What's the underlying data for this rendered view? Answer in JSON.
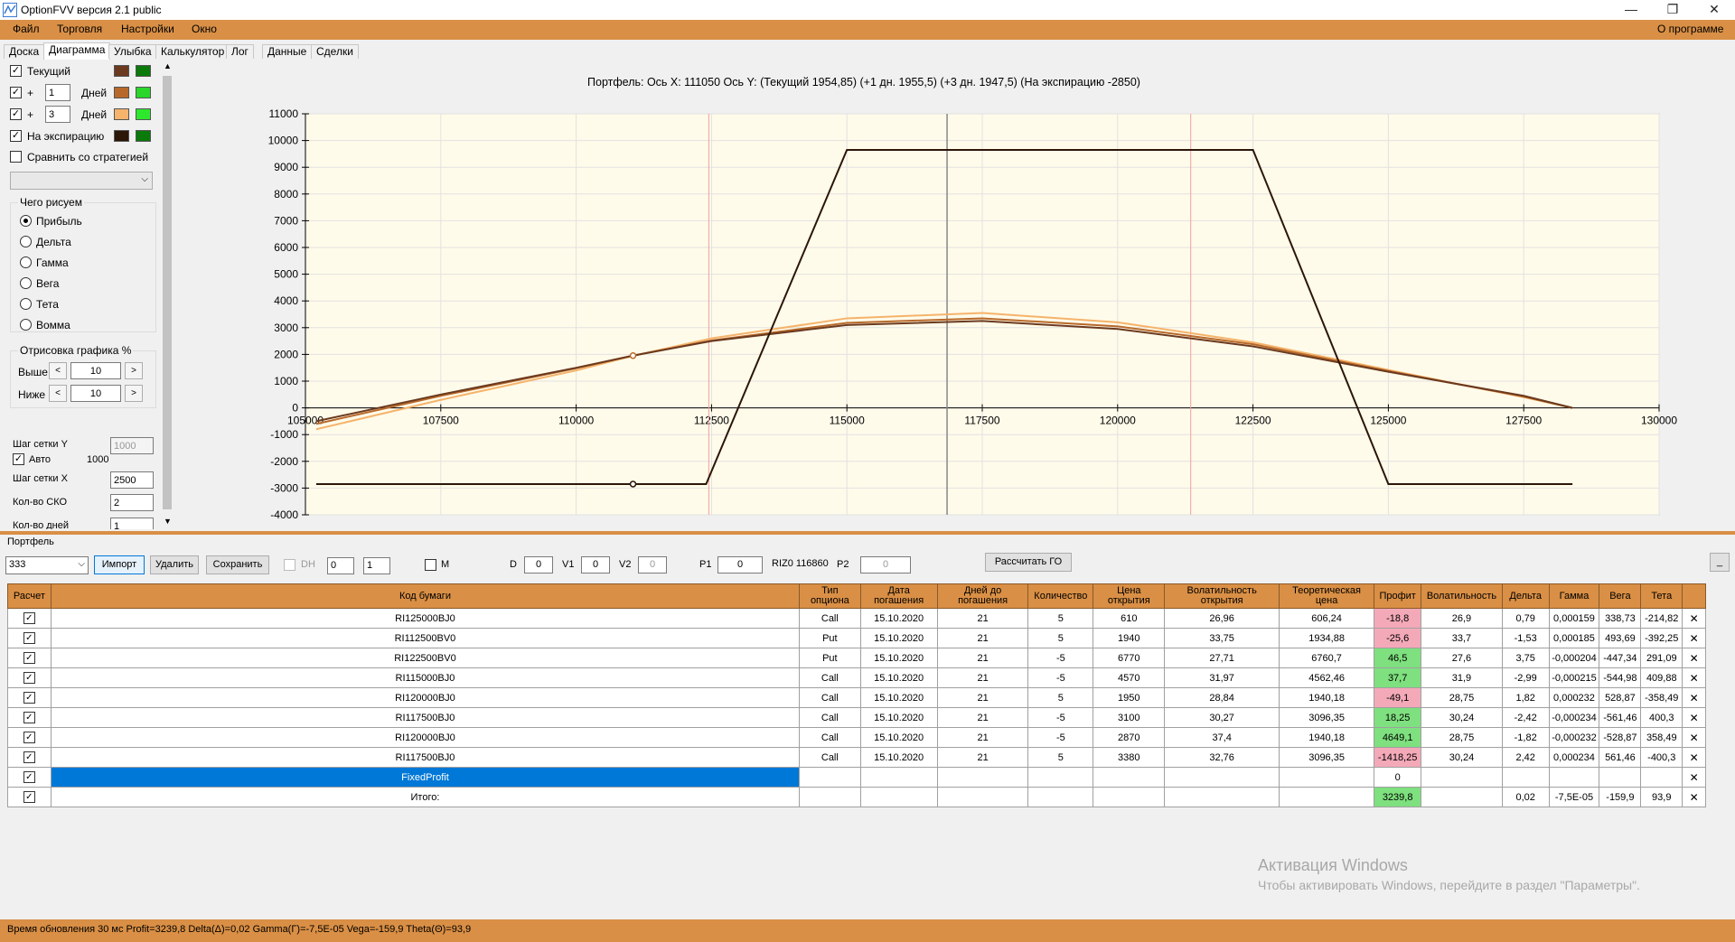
{
  "window": {
    "title": "OptionFVV версия 2.1 public",
    "min": "—",
    "max": "❐",
    "close": "✕"
  },
  "menu": {
    "items": [
      "Файл",
      "Торговля",
      "Настройки",
      "Окно"
    ],
    "right": "О программе"
  },
  "tabs": [
    "Доска",
    "Диаграмма",
    "Улыбка",
    "Калькулятор",
    "Лог",
    "Данные",
    "Сделки"
  ],
  "left": {
    "current_label": "Текущий",
    "plus": "+",
    "days1": "1",
    "days3": "3",
    "days_label": "Дней",
    "expiry_label": "На экспирацию",
    "compare_label": "Сравнить со стратегией",
    "what_group": "Чего рисуем",
    "radios": [
      "Прибыль",
      "Дельта",
      "Гамма",
      "Вега",
      "Тета",
      "Вомма"
    ],
    "draw_group": "Отрисовка графика %",
    "above_label": "Выше",
    "above_val": "10",
    "below_label": "Ниже",
    "below_val": "10",
    "stepy_label": "Шаг сетки Y",
    "stepy_val": "1000",
    "auto_label": "Авто",
    "auto_val": "1000",
    "stepx_label": "Шаг сетки X",
    "stepx_val": "2500",
    "sko_label": "Кол-во СКО",
    "sko_val": "2",
    "days_count_label": "Кол-во дней",
    "days_count_val": "1",
    "colors": {
      "cur_brown": "#6b3a1f",
      "cur_green": "#0b7a0b",
      "d1_brown": "#b8692a",
      "d1_green": "#29d629",
      "d3_orange": "#f5b36b",
      "d3_green": "#2ee82e",
      "exp_dark": "#2b1608",
      "exp_green": "#0a7a0a"
    }
  },
  "chart_data": {
    "type": "line",
    "title": "Портфель: Ось X:  111050 Ось Y:  (Текущий 1954,85)  (+1 дн. 1955,5)  (+3 дн. 1947,5)  (На экспирацию -2850)",
    "xlim": [
      105000,
      130000
    ],
    "ylim": [
      -4000,
      11000
    ],
    "xticks": [
      105000,
      107500,
      110000,
      112500,
      115000,
      117500,
      120000,
      122500,
      125000,
      127500,
      130000
    ],
    "yticks": [
      11000,
      10000,
      9000,
      8000,
      7000,
      6000,
      5000,
      4000,
      3000,
      2000,
      1000,
      0,
      -1000,
      -2000,
      -3000,
      -4000
    ],
    "grid": true,
    "cursor_x": 116850,
    "sd_lines": [
      112450,
      121350
    ],
    "series": [
      {
        "color": "#2b1608",
        "x": [
          105200,
          112400,
          115000,
          122500,
          125000,
          128400
        ],
        "y": [
          -2850,
          -2850,
          9650,
          9650,
          -2850,
          -2850
        ]
      },
      {
        "color": "#6b3a1f",
        "x": [
          105200,
          107500,
          110000,
          111050,
          112500,
          115000,
          117500,
          120000,
          122500,
          125000,
          127500,
          128400
        ],
        "y": [
          -500,
          500,
          1500,
          1955,
          2500,
          3100,
          3250,
          2950,
          2300,
          1350,
          450,
          0
        ]
      },
      {
        "color": "#b8692a",
        "x": [
          105200,
          107500,
          110000,
          111050,
          112500,
          115000,
          117500,
          120000,
          122500,
          125000,
          127500,
          128400
        ],
        "y": [
          -600,
          450,
          1480,
          1955,
          2520,
          3180,
          3350,
          3050,
          2380,
          1380,
          420,
          0
        ]
      },
      {
        "color": "#f5b36b",
        "x": [
          105200,
          107500,
          110000,
          111050,
          112500,
          115000,
          117500,
          120000,
          122500,
          125000,
          127500,
          128400
        ],
        "y": [
          -800,
          300,
          1400,
          1947,
          2600,
          3350,
          3550,
          3200,
          2450,
          1420,
          400,
          0
        ]
      }
    ],
    "markers": [
      {
        "x": 111050,
        "y": 1955,
        "color": "#b8692a"
      },
      {
        "x": 111050,
        "y": -2850,
        "color": "#2b1608"
      }
    ]
  },
  "portfolio": {
    "label": "Портфель",
    "combo": "333",
    "buttons": [
      "Импорт",
      "Удалить",
      "Сохранить"
    ],
    "dh": "DH",
    "spin1": "0",
    "spin2": "1",
    "m": "M",
    "d_label": "D",
    "d_val": "0",
    "v1_label": "V1",
    "v1_val": "0",
    "v2_label": "V2",
    "v2_val": "0",
    "p1_label": "P1",
    "p1_val": "0",
    "riz": "RIZ0 116860",
    "p2_label": "P2",
    "p2_val": "0",
    "calc_btn": "Рассчитать ГО",
    "min_btn": "_",
    "headers": [
      "Расчет",
      "Код бумаги",
      "Тип опциона",
      "Дата погашения",
      "Дней до погашения",
      "Количество",
      "Цена открытия",
      "Волатильность открытия",
      "Теоретическая цена",
      "Профит",
      "Волатильность",
      "Дельта",
      "Гамма",
      "Вега",
      "Тета",
      ""
    ],
    "rows": [
      {
        "code": "RI125000BJ0",
        "type": "Call",
        "date": "15.10.2020",
        "days": "21",
        "qty": "5",
        "price": "610",
        "vol_open": "26,96",
        "theo": "606,24",
        "profit": "-18,8",
        "pclass": "red",
        "vol": "26,9",
        "delta": "0,79",
        "gamma": "0,000159",
        "vega": "338,73",
        "theta": "-214,82"
      },
      {
        "code": "RI112500BV0",
        "type": "Put",
        "date": "15.10.2020",
        "days": "21",
        "qty": "5",
        "price": "1940",
        "vol_open": "33,75",
        "theo": "1934,88",
        "profit": "-25,6",
        "pclass": "red",
        "vol": "33,7",
        "delta": "-1,53",
        "gamma": "0,000185",
        "vega": "493,69",
        "theta": "-392,25"
      },
      {
        "code": "RI122500BV0",
        "type": "Put",
        "date": "15.10.2020",
        "days": "21",
        "qty": "-5",
        "price": "6770",
        "vol_open": "27,71",
        "theo": "6760,7",
        "profit": "46,5",
        "pclass": "green",
        "vol": "27,6",
        "delta": "3,75",
        "gamma": "-0,000204",
        "vega": "-447,34",
        "theta": "291,09"
      },
      {
        "code": "RI115000BJ0",
        "type": "Call",
        "date": "15.10.2020",
        "days": "21",
        "qty": "-5",
        "price": "4570",
        "vol_open": "31,97",
        "theo": "4562,46",
        "profit": "37,7",
        "pclass": "green",
        "vol": "31,9",
        "delta": "-2,99",
        "gamma": "-0,000215",
        "vega": "-544,98",
        "theta": "409,88"
      },
      {
        "code": "RI120000BJ0",
        "type": "Call",
        "date": "15.10.2020",
        "days": "21",
        "qty": "5",
        "price": "1950",
        "vol_open": "28,84",
        "theo": "1940,18",
        "profit": "-49,1",
        "pclass": "red",
        "vol": "28,75",
        "delta": "1,82",
        "gamma": "0,000232",
        "vega": "528,87",
        "theta": "-358,49"
      },
      {
        "code": "RI117500BJ0",
        "type": "Call",
        "date": "15.10.2020",
        "days": "21",
        "qty": "-5",
        "price": "3100",
        "vol_open": "30,27",
        "theo": "3096,35",
        "profit": "18,25",
        "pclass": "green",
        "vol": "30,24",
        "delta": "-2,42",
        "gamma": "-0,000234",
        "vega": "-561,46",
        "theta": "400,3"
      },
      {
        "code": "RI120000BJ0",
        "type": "Call",
        "date": "15.10.2020",
        "days": "21",
        "qty": "-5",
        "price": "2870",
        "vol_open": "37,4",
        "theo": "1940,18",
        "profit": "4649,1",
        "pclass": "green",
        "vol": "28,75",
        "delta": "-1,82",
        "gamma": "-0,000232",
        "vega": "-528,87",
        "theta": "358,49"
      },
      {
        "code": "RI117500BJ0",
        "type": "Call",
        "date": "15.10.2020",
        "days": "21",
        "qty": "5",
        "price": "3380",
        "vol_open": "32,76",
        "theo": "3096,35",
        "profit": "-1418,25",
        "pclass": "red",
        "vol": "30,24",
        "delta": "2,42",
        "gamma": "0,000234",
        "vega": "561,46",
        "theta": "-400,3"
      }
    ],
    "fixed": {
      "code": "FixedProfit",
      "profit": "0"
    },
    "total": {
      "code": "Итого:",
      "profit": "3239,8",
      "delta": "0,02",
      "gamma": "-7,5E-05",
      "vega": "-159,9",
      "theta": "93,9"
    },
    "check": "✓",
    "xmark": "✕"
  },
  "status": "Время обновления 30 мс  Profit=3239,8 Delta(Δ)=0,02 Gamma(Γ)=-7,5E-05 Vega=-159,9 Theta(Θ)=93,9",
  "watermark": {
    "line1": "Активация Windows",
    "line2": "Чтобы активировать Windows, перейдите в раздел \"Параметры\"."
  }
}
